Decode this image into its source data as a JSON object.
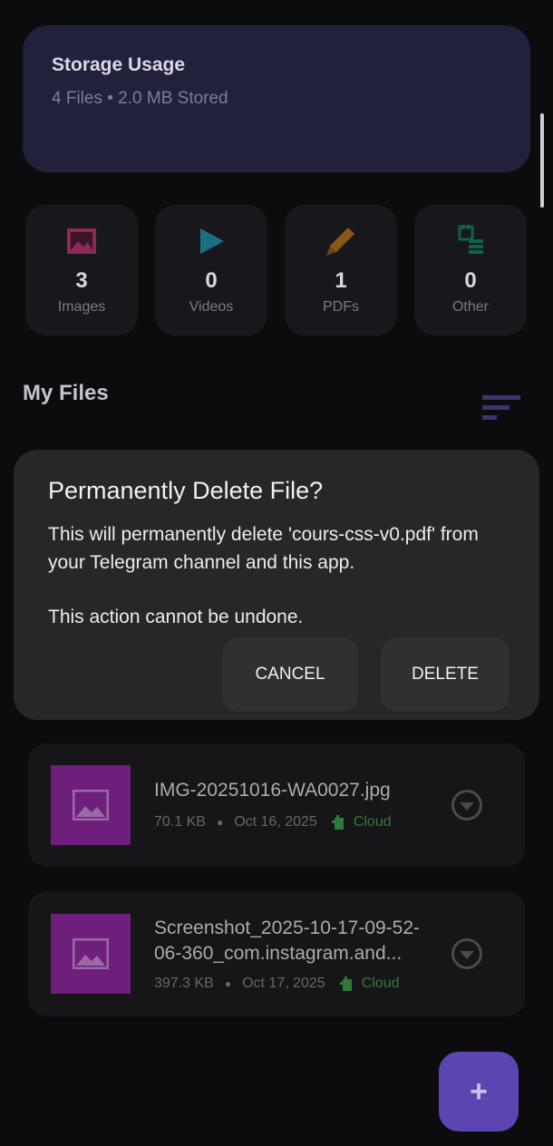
{
  "storage": {
    "title": "Storage Usage",
    "subtitle": "4 Files • 2.0 MB Stored"
  },
  "stats": [
    {
      "icon": "image-icon",
      "count": "3",
      "label": "Images",
      "color": "#8a2a55"
    },
    {
      "icon": "play-icon",
      "count": "0",
      "label": "Videos",
      "color": "#1a6f85"
    },
    {
      "icon": "pencil-icon",
      "count": "1",
      "label": "PDFs",
      "color": "#8a5a14"
    },
    {
      "icon": "sd-card-icon",
      "count": "0",
      "label": "Other",
      "color": "#11604a"
    }
  ],
  "files_heading": "My Files",
  "dialog": {
    "title": "Permanently Delete File?",
    "message_line1": "This will permanently delete 'cours-css-v0.pdf' from your Telegram channel and this app.",
    "message_line2": "This action cannot be undone.",
    "cancel_label": "CANCEL",
    "delete_label": "DELETE"
  },
  "files": [
    {
      "name": "IMG-20251016-WA0027.jpg",
      "size": "70.1 KB",
      "date": "Oct 16, 2025",
      "location": "Cloud"
    },
    {
      "name": "Screenshot_2025-10-17-09-52-06-360_com.instagram.and...",
      "size": "397.3 KB",
      "date": "Oct 17, 2025",
      "location": "Cloud"
    }
  ],
  "fab_label": "+",
  "colors": {
    "accent": "#5c45b0",
    "card": "#22213c",
    "dialog": "#27272a",
    "thumb": "#6e1f7c",
    "cloud": "#2f7a3a"
  }
}
